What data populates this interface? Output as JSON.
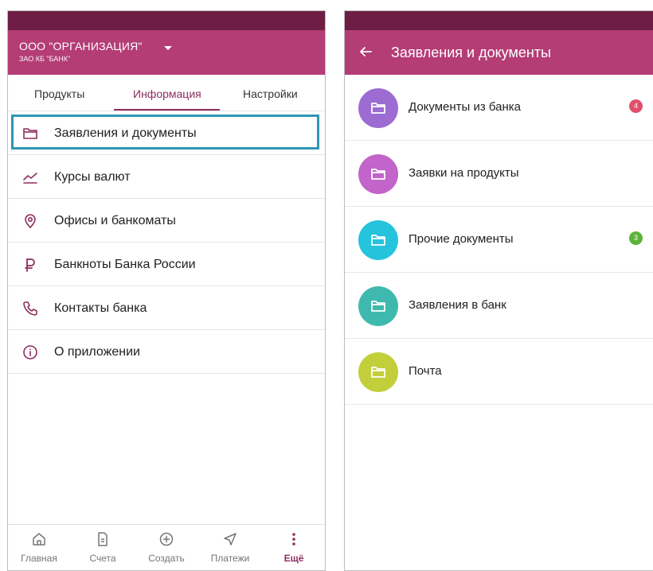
{
  "colors": {
    "status_bar": "#6e1e44",
    "app_bar": "#b43d76",
    "accent": "#8e2d60",
    "highlight_box": "#2e96b4"
  },
  "left_screen": {
    "header": {
      "org_name": "ООО \"ОРГАНИЗАЦИЯ\"",
      "bank_name": "ЗАО КБ \"БАНК\""
    },
    "tabs": [
      {
        "label": "Продукты",
        "active": false
      },
      {
        "label": "Информация",
        "active": true
      },
      {
        "label": "Настройки",
        "active": false
      }
    ],
    "menu": [
      {
        "label": "Заявления и документы",
        "icon": "folder-icon",
        "selected": true
      },
      {
        "label": "Курсы валют",
        "icon": "trend-icon"
      },
      {
        "label": "Офисы и банкоматы",
        "icon": "location-icon"
      },
      {
        "label": "Банкноты Банка России",
        "icon": "ruble-icon"
      },
      {
        "label": "Контакты банка",
        "icon": "phone-icon"
      },
      {
        "label": "О приложении",
        "icon": "info-icon"
      }
    ],
    "bottom_nav": [
      {
        "label": "Главная",
        "icon": "home-icon"
      },
      {
        "label": "Счета",
        "icon": "document-icon"
      },
      {
        "label": "Создать",
        "icon": "plus-circle-icon"
      },
      {
        "label": "Платежи",
        "icon": "send-icon"
      },
      {
        "label": "Ещё",
        "icon": "more-vertical-icon",
        "active": true
      }
    ]
  },
  "right_screen": {
    "title": "Заявления и документы",
    "items": [
      {
        "label": "Документы из банка",
        "color": "#9c6cd2",
        "badge": "4",
        "badge_color": "#e0506a"
      },
      {
        "label": "Заявки на продукты",
        "color": "#c264c9"
      },
      {
        "label": "Прочие документы",
        "color": "#25c3dc",
        "badge": "3",
        "badge_color": "#5cb33a"
      },
      {
        "label": "Заявления в банк",
        "color": "#3fb9ad"
      },
      {
        "label": "Почта",
        "color": "#c2cf3a"
      }
    ]
  }
}
